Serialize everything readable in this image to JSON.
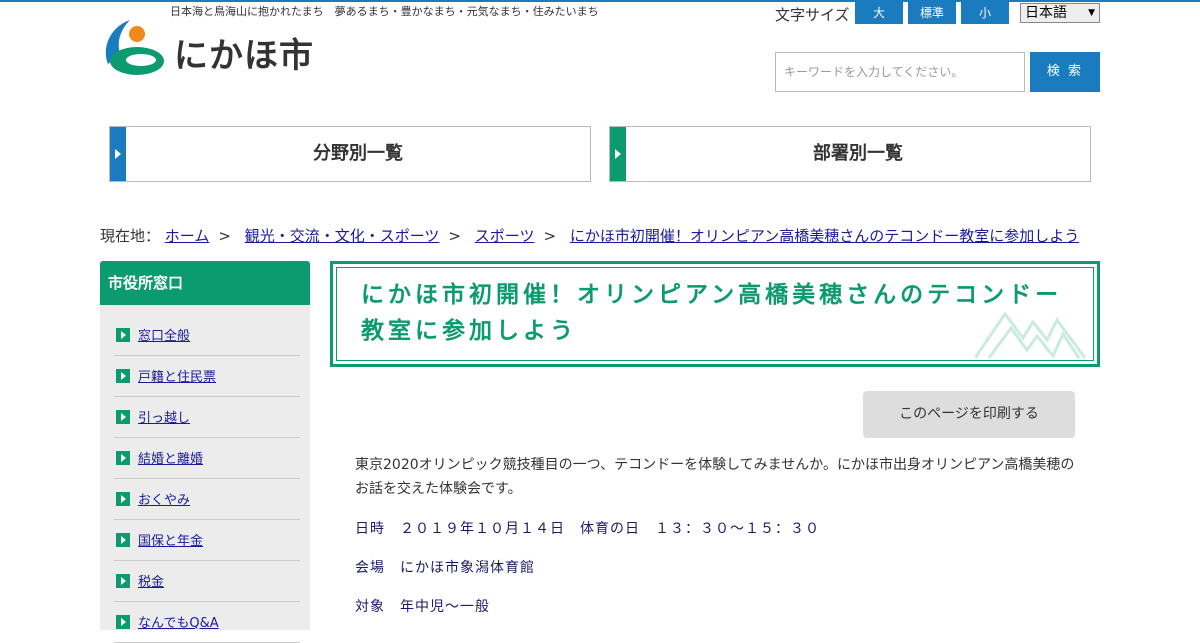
{
  "header": {
    "tagline": "日本海と鳥海山に抱かれたまち　夢あるまち・豊かなまち・元気なまち・住みたいまち",
    "logo_text": "にかほ市",
    "fontsize_label": "文字サイズ",
    "fontsize_options": [
      "大",
      "標準",
      "小"
    ],
    "language": "日本語",
    "search_placeholder": "キーワードを入力してください。",
    "search_button": "検 索",
    "brand_colors": {
      "blue": "#1a7bbf",
      "green": "#0c9b6e",
      "orange": "#f08a1c"
    }
  },
  "nav": [
    {
      "label": "分野別一覧",
      "accent": "#1a7bbf"
    },
    {
      "label": "部署別一覧",
      "accent": "#0c9b6e"
    }
  ],
  "breadcrumb": {
    "prefix": "現在地：",
    "items": [
      "ホーム",
      "観光・交流・文化・スポーツ",
      "スポーツ",
      "にかほ市初開催！オリンピアン高橋美穂さんのテコンドー教室に参加しよう"
    ],
    "separator": ">"
  },
  "sidebar": {
    "title": "市役所窓口",
    "items": [
      {
        "label": "窓口全般"
      },
      {
        "label": "戸籍と住民票"
      },
      {
        "label": "引っ越し"
      },
      {
        "label": "結婚と離婚"
      },
      {
        "label": "おくやみ"
      },
      {
        "label": "国保と年金"
      },
      {
        "label": "税金"
      },
      {
        "label": "なんでもQ&A"
      }
    ]
  },
  "main": {
    "title": "にかほ市初開催！オリンピアン高橋美穂さんのテコンドー教室に参加しよう",
    "print_button": "このページを印刷する",
    "intro": "東京2020オリンピック競技種目の一つ、テコンドーを体験してみませんか。にかほ市出身オリンピアン高橋美穂のお話を交えた体験会です。",
    "datetime": "日時　２０１９年１０月１４日　体育の日　１３：３０～１５：３０",
    "venue": "会場　にかほ市象潟体育館",
    "target": "対象　年中児～一般"
  }
}
